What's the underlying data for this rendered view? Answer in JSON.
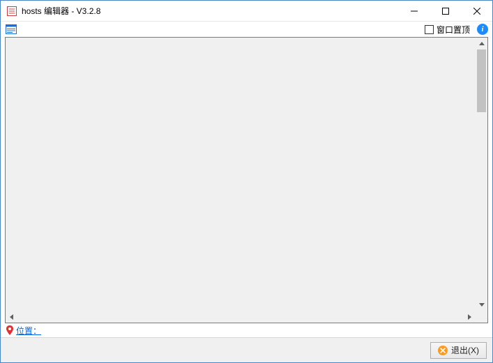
{
  "titlebar": {
    "title": "hosts 编辑器 - V3.2.8"
  },
  "toolbar": {
    "always_on_top_label": "窗口置顶",
    "always_on_top_checked": false
  },
  "editor": {
    "content": ""
  },
  "status": {
    "path_label": "位置：",
    "path_value": ""
  },
  "buttons": {
    "exit_label": "退出(X)"
  }
}
